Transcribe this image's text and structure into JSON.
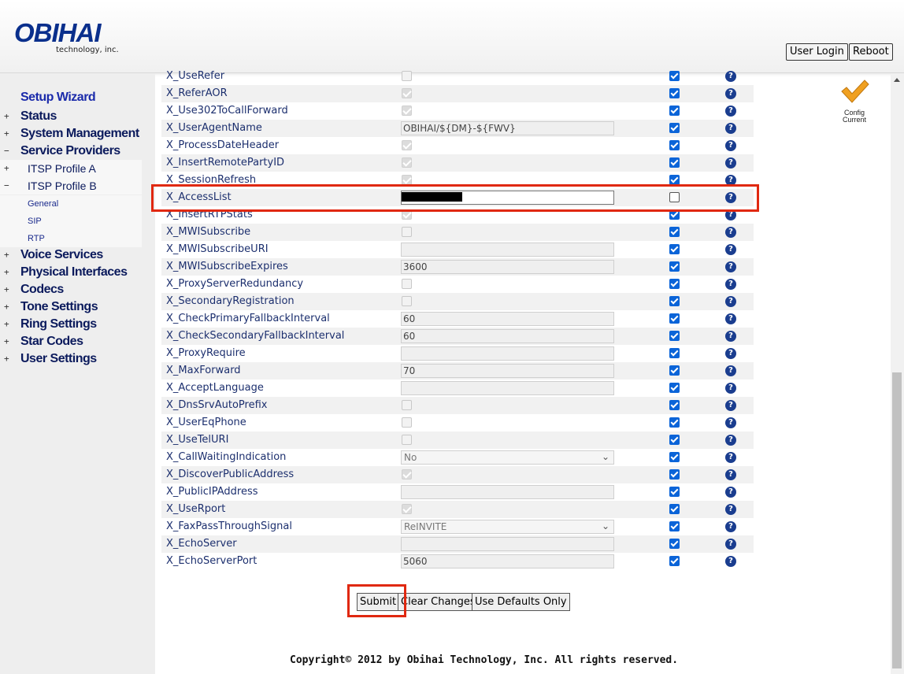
{
  "header": {
    "logo": "OBIHAI",
    "logo_sub": "technology, inc.",
    "user_login": "User Login",
    "reboot": "Reboot"
  },
  "sidebar": {
    "wizard": "Setup Wizard",
    "items": [
      {
        "label": "Status",
        "pm": "+"
      },
      {
        "label": "System Management",
        "pm": "+"
      },
      {
        "label": "Service Providers",
        "pm": "−"
      },
      {
        "label": "ITSP Profile A",
        "pm": "+"
      },
      {
        "label": "ITSP Profile B",
        "pm": "−"
      },
      {
        "label": "General"
      },
      {
        "label": "SIP"
      },
      {
        "label": "RTP"
      },
      {
        "label": "Voice Services",
        "pm": "+"
      },
      {
        "label": "Physical Interfaces",
        "pm": "+"
      },
      {
        "label": "Codecs",
        "pm": "+"
      },
      {
        "label": "Tone Settings",
        "pm": "+"
      },
      {
        "label": "Ring Settings",
        "pm": "+"
      },
      {
        "label": "Star Codes",
        "pm": "+"
      },
      {
        "label": "User Settings",
        "pm": "+"
      }
    ]
  },
  "rows": [
    {
      "name": "X_UseRefer",
      "type": "checkbox",
      "checked": false,
      "default": true
    },
    {
      "name": "X_ReferAOR",
      "type": "checkbox",
      "checked": true,
      "default": true
    },
    {
      "name": "X_Use302ToCallForward",
      "type": "checkbox",
      "checked": true,
      "default": true
    },
    {
      "name": "X_UserAgentName",
      "type": "text",
      "value": "OBIHAI/${DM}-${FWV}",
      "default": true
    },
    {
      "name": "X_ProcessDateHeader",
      "type": "checkbox",
      "checked": true,
      "default": true
    },
    {
      "name": "X_InsertRemotePartyID",
      "type": "checkbox",
      "checked": true,
      "default": true
    },
    {
      "name": "X_SessionRefresh",
      "type": "checkbox",
      "checked": true,
      "default": true
    },
    {
      "name": "X_AccessList",
      "type": "text-active",
      "value": "",
      "default": false
    },
    {
      "name": "X_InsertRTPStats",
      "type": "checkbox",
      "checked": true,
      "default": true
    },
    {
      "name": "X_MWISubscribe",
      "type": "checkbox",
      "checked": false,
      "default": true
    },
    {
      "name": "X_MWISubscribeURI",
      "type": "text",
      "value": "",
      "default": true
    },
    {
      "name": "X_MWISubscribeExpires",
      "type": "text",
      "value": "3600",
      "default": true
    },
    {
      "name": "X_ProxyServerRedundancy",
      "type": "checkbox",
      "checked": false,
      "default": true
    },
    {
      "name": "X_SecondaryRegistration",
      "type": "checkbox",
      "checked": false,
      "default": true
    },
    {
      "name": "X_CheckPrimaryFallbackInterval",
      "type": "text",
      "value": "60",
      "default": true
    },
    {
      "name": "X_CheckSecondaryFallbackInterval",
      "type": "text",
      "value": "60",
      "default": true
    },
    {
      "name": "X_ProxyRequire",
      "type": "text",
      "value": "",
      "default": true
    },
    {
      "name": "X_MaxForward",
      "type": "text",
      "value": "70",
      "default": true
    },
    {
      "name": "X_AcceptLanguage",
      "type": "text",
      "value": "",
      "default": true
    },
    {
      "name": "X_DnsSrvAutoPrefix",
      "type": "checkbox",
      "checked": false,
      "default": true
    },
    {
      "name": "X_UserEqPhone",
      "type": "checkbox",
      "checked": false,
      "default": true
    },
    {
      "name": "X_UseTelURI",
      "type": "checkbox",
      "checked": false,
      "default": true
    },
    {
      "name": "X_CallWaitingIndication",
      "type": "select",
      "value": "No",
      "default": true
    },
    {
      "name": "X_DiscoverPublicAddress",
      "type": "checkbox",
      "checked": true,
      "default": true
    },
    {
      "name": "X_PublicIPAddress",
      "type": "text",
      "value": "",
      "default": true
    },
    {
      "name": "X_UseRport",
      "type": "checkbox",
      "checked": true,
      "default": true
    },
    {
      "name": "X_FaxPassThroughSignal",
      "type": "select",
      "value": "ReINVITE",
      "default": true
    },
    {
      "name": "X_EchoServer",
      "type": "text",
      "value": "",
      "default": true
    },
    {
      "name": "X_EchoServerPort",
      "type": "text",
      "value": "5060",
      "default": true
    }
  ],
  "buttons": {
    "submit": "Submit",
    "clear": "Clear Changes",
    "defaults": "Use Defaults Only"
  },
  "status": {
    "line1": "Config",
    "line2": "Current"
  },
  "copyright": "Copyright© 2012 by Obihai Technology, Inc. All rights reserved.",
  "colors": {
    "brand": "#0a2f8c",
    "nav_text": "#0b1a5c",
    "highlight": "#e02810",
    "check_accent": "#0b64d8",
    "help_icon": "#1a3d8f"
  }
}
